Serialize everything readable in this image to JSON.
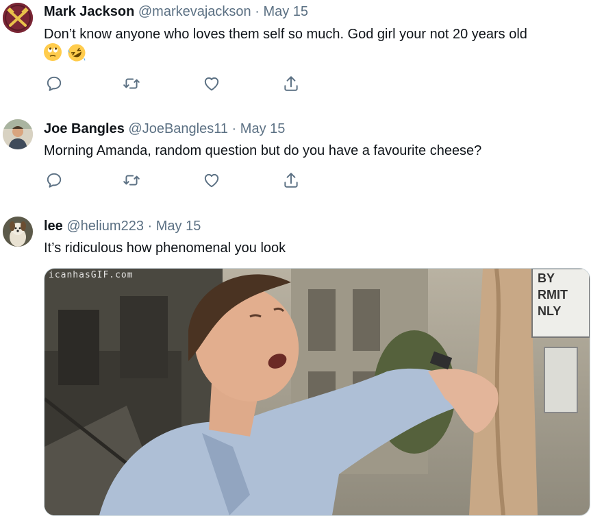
{
  "tweets": [
    {
      "name": "Mark Jackson",
      "handle": "@markevajackson",
      "separator": "·",
      "date": "May 15",
      "text": "Don’t know anyone who loves them self so much. God girl your not 20 years old",
      "emojis": [
        "face-with-rolling-eyes",
        "rolling-on-the-floor-laughing"
      ],
      "avatar_icon": "crossed-hammers-crest-icon"
    },
    {
      "name": "Joe Bangles",
      "handle": "@JoeBangles11",
      "separator": "·",
      "date": "May 15",
      "text": "Morning Amanda, random question but do you have a favourite cheese?",
      "avatar_icon": "profile-photo"
    },
    {
      "name": "lee",
      "handle": "@helium223",
      "separator": "·",
      "date": "May 15",
      "text": "It’s ridiculous how phenomenal you look",
      "avatar_icon": "dog-photo",
      "media": {
        "type": "gif",
        "watermark": "icanhasGIF.com",
        "sign_lines": [
          "BY",
          "RMIT",
          "NLY"
        ]
      }
    }
  ],
  "action_icons": [
    "reply-icon",
    "retweet-icon",
    "like-icon",
    "share-icon"
  ],
  "colors": {
    "text": "#0f1419",
    "secondary": "#5b7083",
    "icon": "#5b7083",
    "avatar_bg_1": "#7a2635"
  }
}
